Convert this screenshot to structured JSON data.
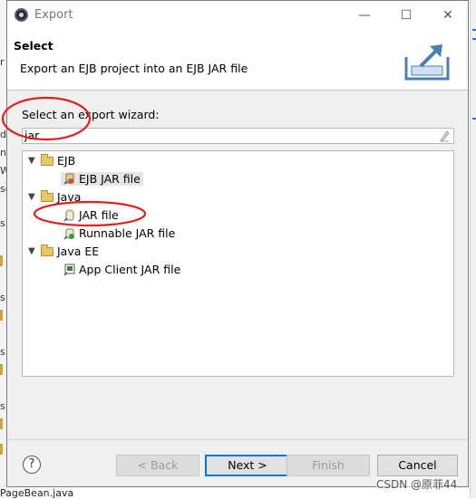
{
  "window": {
    "title": "Export",
    "minimize": "—",
    "maximize": "☐",
    "close": "✕"
  },
  "banner": {
    "title": "Select",
    "description": "Export an EJB project into an EJB JAR file",
    "icon": "export-wizard-icon"
  },
  "wizard": {
    "label": "Select an export wizard:",
    "filter_value": "jar"
  },
  "tree": {
    "groups": [
      {
        "label": "EJB",
        "items": [
          {
            "label": "EJB JAR file",
            "icon": "ejb-jar-icon",
            "selected": true
          }
        ]
      },
      {
        "label": "Java",
        "items": [
          {
            "label": "JAR file",
            "icon": "jar-icon",
            "selected": false
          },
          {
            "label": "Runnable JAR file",
            "icon": "runnable-jar-icon",
            "selected": false
          }
        ]
      },
      {
        "label": "Java EE",
        "items": [
          {
            "label": "App Client JAR file",
            "icon": "app-client-jar-icon",
            "selected": false
          }
        ]
      }
    ]
  },
  "buttons": {
    "help": "?",
    "back": "< Back",
    "next": "Next >",
    "finish": "Finish",
    "cancel": "Cancel"
  },
  "background": {
    "bottom_file": "PageBean.java",
    "left_fragments": [
      "r",
      "d",
      "ne",
      "W",
      "so",
      "s.",
      "s.",
      "s.",
      "s."
    ]
  },
  "watermark": "CSDN @原菲44",
  "colors": {
    "annotation_red": "#e0201c",
    "default_button_border": "#0078d7"
  }
}
